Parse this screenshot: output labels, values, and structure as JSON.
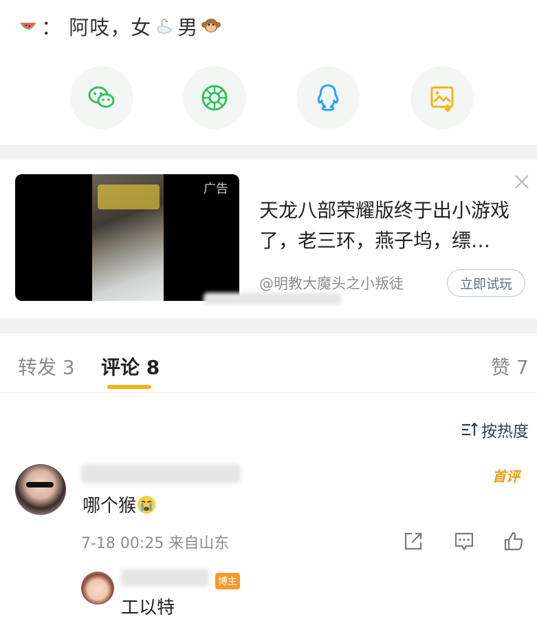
{
  "post": {
    "watermelon_icon": "watermelon-icon",
    "text_a": "： 阿吱，女",
    "swan_icon": "swan-icon",
    "text_b": "男",
    "monkey_icon": "monkey-icon"
  },
  "share": {
    "items": [
      {
        "name": "wechat-icon",
        "color": "#2fc261"
      },
      {
        "name": "moments-icon",
        "color": "#2fc261"
      },
      {
        "name": "qq-icon",
        "color": "#2aa2f5"
      },
      {
        "name": "save-image-icon",
        "color": "#f3b41a"
      }
    ]
  },
  "ad": {
    "badge": "广告",
    "title": "天龙八部荣耀版终于出小游戏了，老三环，燕子坞，缥…",
    "source": "@明教大魔头之小叛徒",
    "cta": "立即试玩",
    "close_icon": "close-icon"
  },
  "tabs": {
    "repost": "转发 3",
    "comment": "评论 8",
    "like": "赞 7",
    "accent": "#f3b41a"
  },
  "sort": {
    "label": "按热度",
    "icon": "sort-icon"
  },
  "comment": {
    "text": "哪个猴",
    "emoji": "crying-emoji",
    "meta": "7-18 00:25 来自山东",
    "first_badge": "首评",
    "actions": [
      "share-icon",
      "reply-icon",
      "like-icon"
    ]
  },
  "reply": {
    "host_badge": "博主",
    "partial_text": "工以特"
  }
}
